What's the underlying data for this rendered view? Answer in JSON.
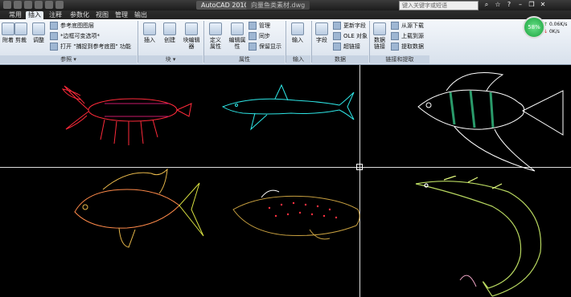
{
  "titlebar": {
    "app_title": "AutoCAD 2010",
    "file_title": "向量鱼类素材.dwg",
    "search_placeholder": "键入关键字或短语",
    "icons": [
      "binoculars-icon",
      "star-icon",
      "help-icon",
      "minimize-icon",
      "restore-icon",
      "close-icon"
    ]
  },
  "tabs": [
    "常用",
    "插入",
    "注释",
    "参数化",
    "视图",
    "管理",
    "输出"
  ],
  "active_tab": "插入",
  "ribbon": {
    "reference_panel": {
      "buttons": [
        "附着",
        "剪裁",
        "调整"
      ],
      "items": [
        "参考底图图层",
        "*边框可变选项*",
        "打开 \"捕捉到参考底图\" 功能"
      ],
      "footer": "参照 ▾"
    },
    "block_panel": {
      "buttons": [
        "插入",
        "创建",
        "块编辑器"
      ],
      "footer": "块 ▾"
    },
    "attributes_panel": {
      "buttons": [
        "定义属性",
        "编辑属性"
      ],
      "items": [
        "管理",
        "同步",
        "保留显示"
      ],
      "footer": "属性"
    },
    "import_panel": {
      "buttons": [
        "输入"
      ],
      "footer": "输入"
    },
    "data_panel": {
      "buttons": [
        "字段"
      ],
      "items": [
        "更新字段",
        "OLE 对象",
        "超链接"
      ],
      "footer": "数据"
    },
    "link_panel": {
      "buttons": [
        "数据链接"
      ],
      "items": [
        "从源下载",
        "上载到源",
        "提取数据"
      ],
      "footer": "链接和提取"
    }
  },
  "status": {
    "percent": "58%",
    "up": "0.06K/s",
    "down": "0K/s"
  },
  "colors": {
    "ribbon_bg": "#e3eaf3",
    "canvas_bg": "#000000",
    "lobster": "#ff2a3a",
    "shark": "#2ee6e6",
    "angelfish": "#ffffff",
    "angelfish_stripes": "#2a9a6a",
    "perch": "#e8b84a",
    "pufferfish": "#c8a040",
    "arowana": "#b8d860"
  }
}
